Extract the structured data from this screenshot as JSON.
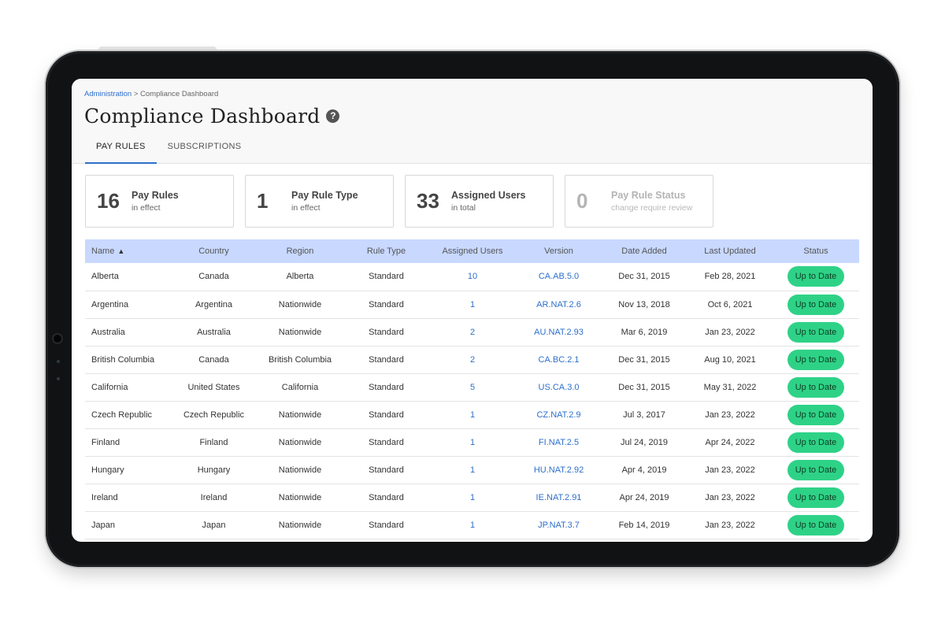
{
  "breadcrumb": {
    "parent": "Administration",
    "separator": " > ",
    "current": "Compliance Dashboard"
  },
  "page": {
    "title": "Compliance Dashboard",
    "help_icon": "?"
  },
  "tabs": [
    {
      "label": "PAY RULES",
      "active": true
    },
    {
      "label": "SUBSCRIPTIONS",
      "active": false
    }
  ],
  "stats": [
    {
      "value": "16",
      "title": "Pay Rules",
      "subtitle": "in effect"
    },
    {
      "value": "1",
      "title": "Pay Rule Type",
      "subtitle": "in effect"
    },
    {
      "value": "33",
      "title": "Assigned Users",
      "subtitle": "in total"
    },
    {
      "value": "0",
      "title": "Pay Rule Status",
      "subtitle": "change require review"
    }
  ],
  "table": {
    "columns": [
      "Name",
      "Country",
      "Region",
      "Rule Type",
      "Assigned Users",
      "Version",
      "Date Added",
      "Last Updated",
      "Status"
    ],
    "sort_indicator": "▲",
    "rows": [
      {
        "name": "Alberta",
        "country": "Canada",
        "region": "Alberta",
        "rule_type": "Standard",
        "users": "10",
        "version": "CA.AB.5.0",
        "added": "Dec 31, 2015",
        "updated": "Feb 28, 2021",
        "status": "Up to Date"
      },
      {
        "name": "Argentina",
        "country": "Argentina",
        "region": "Nationwide",
        "rule_type": "Standard",
        "users": "1",
        "version": "AR.NAT.2.6",
        "added": "Nov 13, 2018",
        "updated": "Oct 6, 2021",
        "status": "Up to Date"
      },
      {
        "name": "Australia",
        "country": "Australia",
        "region": "Nationwide",
        "rule_type": "Standard",
        "users": "2",
        "version": "AU.NAT.2.93",
        "added": "Mar 6, 2019",
        "updated": "Jan 23, 2022",
        "status": "Up to Date"
      },
      {
        "name": "British Columbia",
        "country": "Canada",
        "region": "British Columbia",
        "rule_type": "Standard",
        "users": "2",
        "version": "CA.BC.2.1",
        "added": "Dec 31, 2015",
        "updated": "Aug 10, 2021",
        "status": "Up to Date"
      },
      {
        "name": "California",
        "country": "United States",
        "region": "California",
        "rule_type": "Standard",
        "users": "5",
        "version": "US.CA.3.0",
        "added": "Dec 31, 2015",
        "updated": "May 31, 2022",
        "status": "Up to Date"
      },
      {
        "name": "Czech Republic",
        "country": "Czech Republic",
        "region": "Nationwide",
        "rule_type": "Standard",
        "users": "1",
        "version": "CZ.NAT.2.9",
        "added": "Jul 3, 2017",
        "updated": "Jan 23, 2022",
        "status": "Up to Date"
      },
      {
        "name": "Finland",
        "country": "Finland",
        "region": "Nationwide",
        "rule_type": "Standard",
        "users": "1",
        "version": "FI.NAT.2.5",
        "added": "Jul 24, 2019",
        "updated": "Apr 24, 2022",
        "status": "Up to Date"
      },
      {
        "name": "Hungary",
        "country": "Hungary",
        "region": "Nationwide",
        "rule_type": "Standard",
        "users": "1",
        "version": "HU.NAT.2.92",
        "added": "Apr 4, 2019",
        "updated": "Jan 23, 2022",
        "status": "Up to Date"
      },
      {
        "name": "Ireland",
        "country": "Ireland",
        "region": "Nationwide",
        "rule_type": "Standard",
        "users": "1",
        "version": "IE.NAT.2.91",
        "added": "Apr 24, 2019",
        "updated": "Jan 23, 2022",
        "status": "Up to Date"
      },
      {
        "name": "Japan",
        "country": "Japan",
        "region": "Nationwide",
        "rule_type": "Standard",
        "users": "1",
        "version": "JP.NAT.3.7",
        "added": "Feb 14, 2019",
        "updated": "Jan 23, 2022",
        "status": "Up to Date"
      }
    ]
  },
  "colors": {
    "accent": "#2d6fcb",
    "header_bg": "#c8d8ff",
    "status_green": "#2ed287"
  }
}
